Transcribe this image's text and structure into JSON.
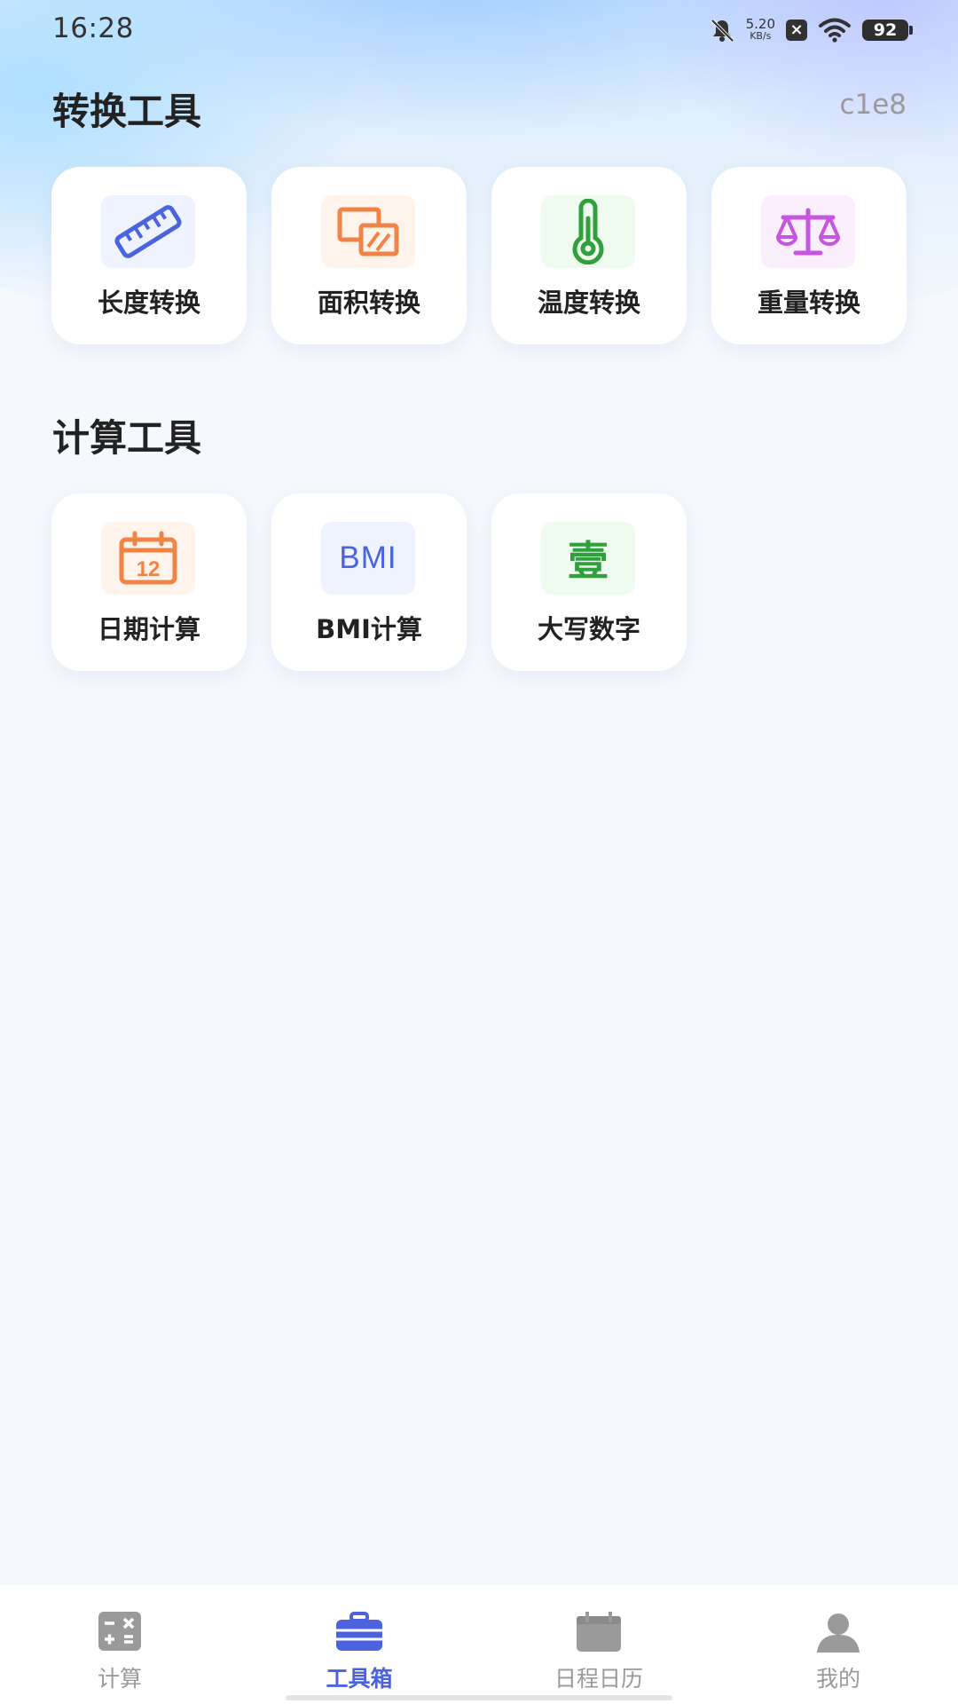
{
  "status_bar": {
    "time": "16:28",
    "net_speed_value": "5.20",
    "net_speed_unit": "KB/s",
    "battery": "92",
    "icons": [
      "bell-muted-icon",
      "app-notification-icon",
      "wifi-icon",
      "battery-icon"
    ]
  },
  "corner_code": "c1e8",
  "sections": {
    "conversion": {
      "title": "转换工具",
      "items": [
        {
          "label": "长度转换",
          "icon": "ruler-icon",
          "color": "#4c63df",
          "bg": "#eef3ff"
        },
        {
          "label": "面积转换",
          "icon": "area-icon",
          "color": "#ef8446",
          "bg": "#fff4ec"
        },
        {
          "label": "温度转换",
          "icon": "thermometer-icon",
          "color": "#2fa03b",
          "bg": "#effbee"
        },
        {
          "label": "重量转换",
          "icon": "scale-icon",
          "color": "#c656e0",
          "bg": "#fbeffd"
        }
      ]
    },
    "calculation": {
      "title": "计算工具",
      "items": [
        {
          "label": "日期计算",
          "icon": "calendar-icon",
          "icon_text": "12",
          "color": "#ef8446",
          "bg": "#fff4ec"
        },
        {
          "label": "BMI计算",
          "icon": "bmi-icon",
          "icon_text": "BMI",
          "color": "#4c63df",
          "bg": "#eef3ff"
        },
        {
          "label": "大写数字",
          "icon": "capital-number-icon",
          "icon_text": "壹",
          "color": "#2fa03b",
          "bg": "#effbee"
        }
      ]
    }
  },
  "bottom_nav": {
    "items": [
      {
        "label": "计算",
        "icon": "calculator-icon",
        "active": false
      },
      {
        "label": "工具箱",
        "icon": "toolbox-icon",
        "active": true
      },
      {
        "label": "日程日历",
        "icon": "calendar-icon",
        "active": false
      },
      {
        "label": "我的",
        "icon": "person-icon",
        "active": false
      }
    ],
    "active_color": "#4c63df",
    "inactive_color": "#9a9a9a"
  }
}
